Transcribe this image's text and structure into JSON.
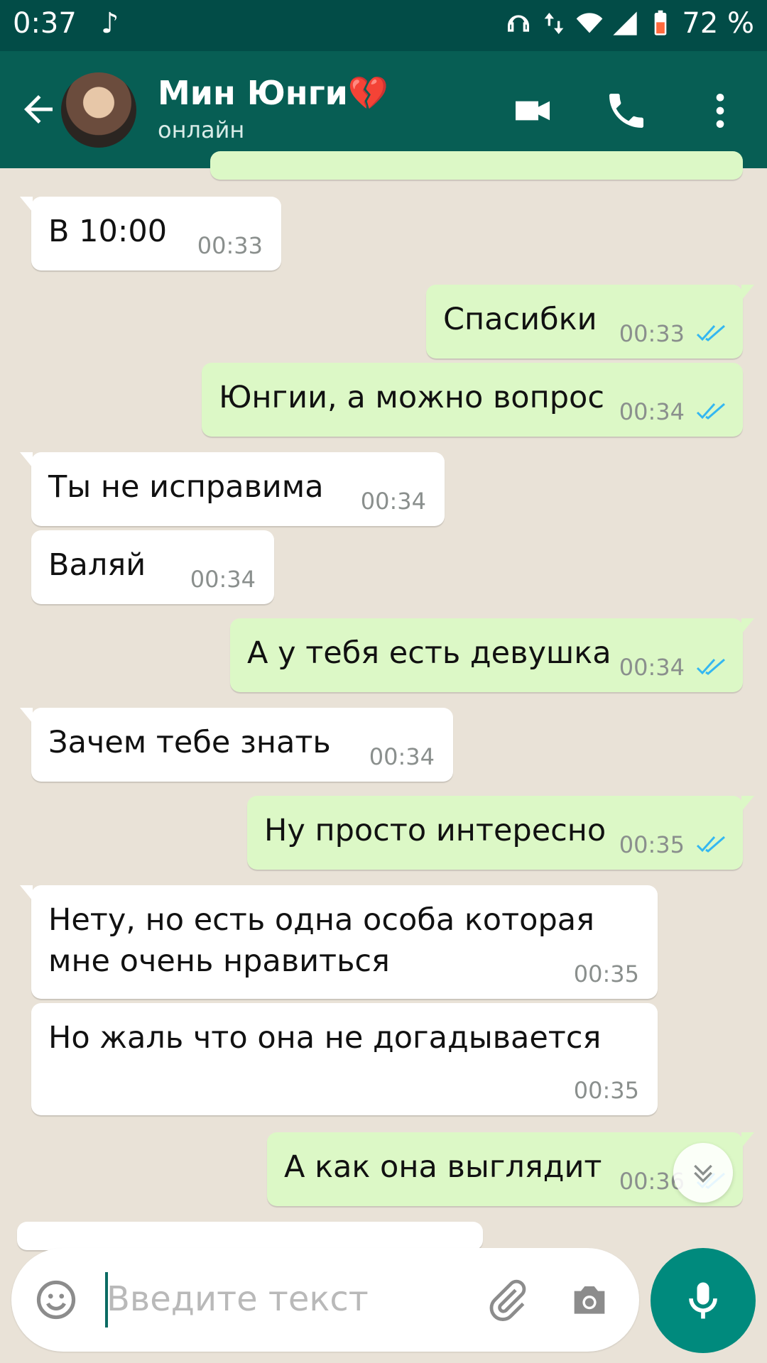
{
  "status_bar": {
    "time": "0:37",
    "battery": "72 %"
  },
  "header": {
    "contact_name": "Мин Юнги💔",
    "status": "онлайн"
  },
  "messages": [
    {
      "dir": "in",
      "text": "В 10:00",
      "time": "00:33"
    },
    {
      "dir": "out",
      "text": "Спасибки",
      "time": "00:33"
    },
    {
      "dir": "out",
      "text": "Юнгии, а можно вопрос",
      "time": "00:34"
    },
    {
      "dir": "in",
      "text": "Ты не исправима",
      "time": "00:34"
    },
    {
      "dir": "in",
      "text": "Валяй",
      "time": "00:34"
    },
    {
      "dir": "out",
      "text": "А у тебя есть девушка",
      "time": "00:34"
    },
    {
      "dir": "in",
      "text": "Зачем тебе знать",
      "time": "00:34"
    },
    {
      "dir": "out",
      "text": "Ну просто интересно",
      "time": "00:35"
    },
    {
      "dir": "in",
      "text": "Нету, но есть одна особа которая\nмне очень нравиться",
      "time": "00:35"
    },
    {
      "dir": "in",
      "text": "Но жаль что она не догадывается",
      "time": "00:35"
    },
    {
      "dir": "out",
      "text": "А как она выглядит",
      "time": "00:36"
    }
  ],
  "input": {
    "placeholder": "Введите текст"
  },
  "colors": {
    "status_bar": "#024c47",
    "header": "#075e54",
    "incoming_bubble": "#ffffff",
    "outgoing_bubble": "#dcf8c6",
    "chat_background": "#e9e2d7",
    "read_ticks": "#34b7f1",
    "mic_button": "#008a7d"
  },
  "icons": {
    "status_left": "music-note-icon",
    "status_right": [
      "headphones-icon",
      "data-arrows-icon",
      "wifi-icon",
      "signal-icon",
      "battery-icon"
    ],
    "header": [
      "back-arrow-icon",
      "video-call-icon",
      "phone-icon",
      "more-vert-icon"
    ],
    "input": [
      "emoji-icon",
      "attach-icon",
      "camera-icon",
      "mic-icon"
    ],
    "scroll": "double-chevron-down-icon"
  }
}
